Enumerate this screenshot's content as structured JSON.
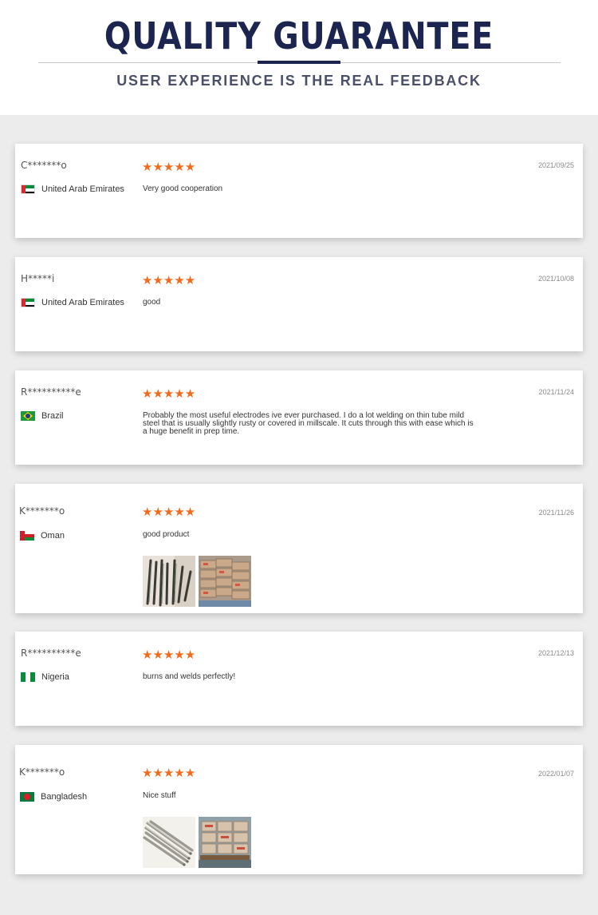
{
  "header": {
    "title": "QUALITY GUARANTEE",
    "subtitle": "USER EXPERIENCE IS THE REAL FEEDBACK"
  },
  "colors": {
    "navy": "#1b2550",
    "star": "#f26a1b"
  },
  "reviews": [
    {
      "user": "C*******o",
      "country": "United Arab Emirates",
      "flag_icon": "uae-flag-icon",
      "rating": 5,
      "stars": "★★★★★",
      "date": "2021/09/25",
      "comment": "Very good cooperation"
    },
    {
      "user": "H*****i",
      "country": "United Arab Emirates",
      "flag_icon": "uae-flag-icon",
      "rating": 5,
      "stars": "★★★★★",
      "date": "2021/10/08",
      "comment": "good"
    },
    {
      "user": "R**********e",
      "country": "Brazil",
      "flag_icon": "brazil-flag-icon",
      "rating": 5,
      "stars": "★★★★★",
      "date": "2021/11/24",
      "comment": "Probably the most useful electrodes ive ever purchased. I do a lot welding on thin tube mild steel that is usually slightly rusty or covered in millscale. It cuts through this with ease which is a huge benefit in prep time."
    },
    {
      "user": "K*******o",
      "country": "Oman",
      "flag_icon": "oman-flag-icon",
      "rating": 5,
      "stars": "★★★★★",
      "date": "2021/11/26",
      "comment": "good product",
      "photos": [
        "electrodes-photo",
        "boxes-photo"
      ]
    },
    {
      "user": "R**********e",
      "country": "Nigeria",
      "flag_icon": "nigeria-flag-icon",
      "rating": 5,
      "stars": "★★★★★",
      "date": "2021/12/13",
      "comment": "burns and welds perfectly!"
    },
    {
      "user": "K*******o",
      "country": "Bangladesh",
      "flag_icon": "bangladesh-flag-icon",
      "rating": 5,
      "stars": "★★★★★",
      "date": "2022/01/07",
      "comment": "Nice stuff",
      "photos": [
        "electrodes-bundle-photo",
        "pallet-boxes-photo"
      ]
    }
  ]
}
